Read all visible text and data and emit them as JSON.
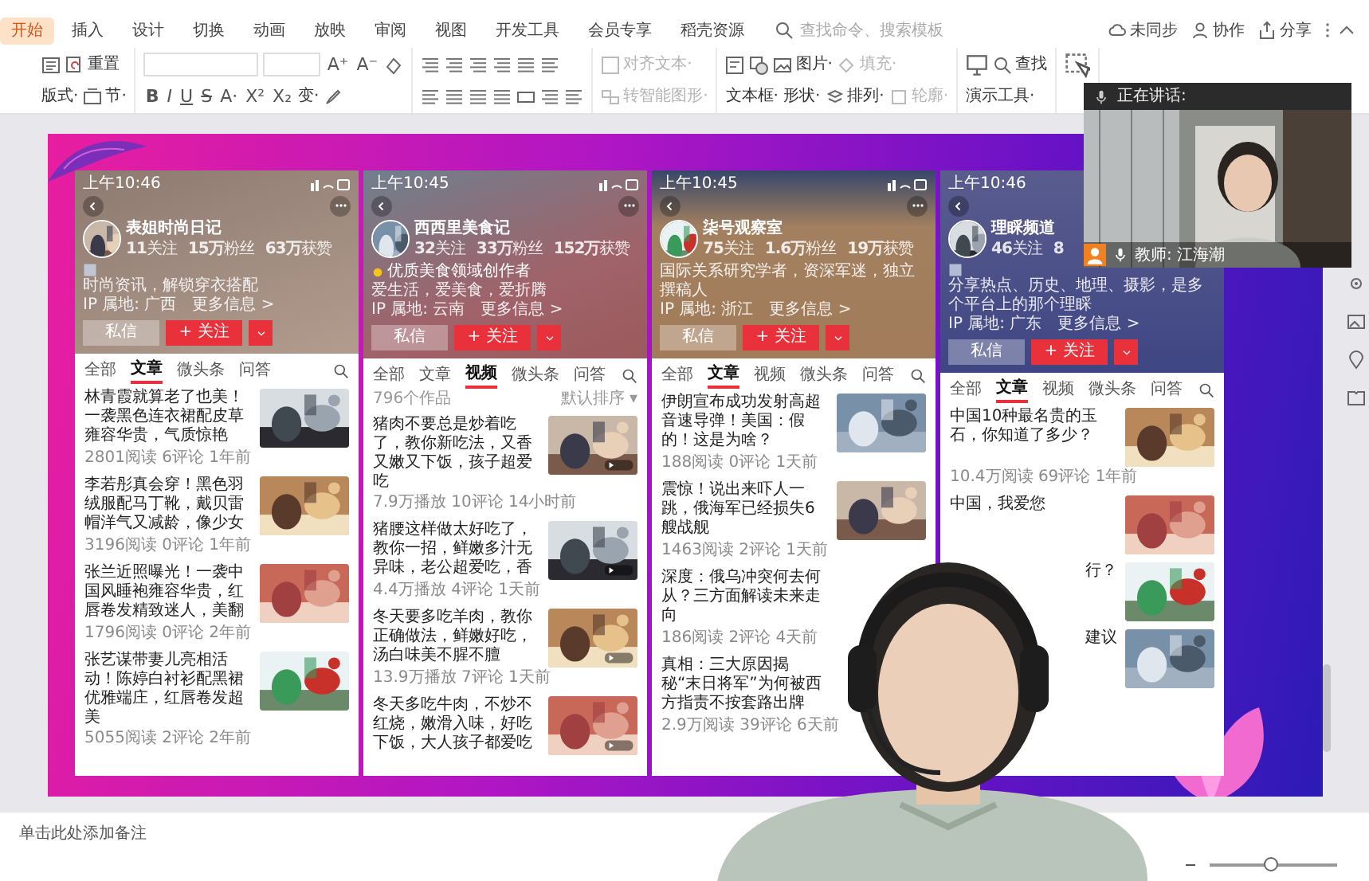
{
  "ribbon": {
    "tabs": [
      {
        "label": "开始",
        "selected": true
      },
      {
        "label": "插入",
        "selected": false
      },
      {
        "label": "设计",
        "selected": false
      },
      {
        "label": "切换",
        "selected": false
      },
      {
        "label": "动画",
        "selected": false
      },
      {
        "label": "放映",
        "selected": false
      },
      {
        "label": "审阅",
        "selected": false
      },
      {
        "label": "视图",
        "selected": false
      },
      {
        "label": "开发工具",
        "selected": false
      },
      {
        "label": "会员专享",
        "selected": false
      },
      {
        "label": "稻壳资源",
        "selected": false
      }
    ],
    "search": {
      "placeholder": "查找命令、搜索模板"
    },
    "actions": [
      {
        "label": "未同步"
      },
      {
        "label": "协作"
      },
      {
        "label": "分享"
      }
    ]
  },
  "toolbar": {
    "labels": [
      {
        "text": "重置",
        "disabled": false
      },
      {
        "text": "对齐文本·",
        "disabled": true
      },
      {
        "text": "图片·",
        "disabled": false
      },
      {
        "text": "填充·",
        "disabled": true
      },
      {
        "text": "查找",
        "disabled": false
      },
      {
        "text": "版式·",
        "disabled": false
      },
      {
        "text": "节·",
        "disabled": false
      },
      {
        "text": "变·",
        "disabled": false
      },
      {
        "text": "转智能图形·",
        "disabled": true
      },
      {
        "text": "文本框·",
        "disabled": false
      },
      {
        "text": "形状·",
        "disabled": false
      },
      {
        "text": "排列·",
        "disabled": false
      },
      {
        "text": "轮廓·",
        "disabled": true
      },
      {
        "text": "演示工具·",
        "disabled": false
      }
    ],
    "glyphs": [
      "A⁺",
      "A⁻",
      "B",
      "I",
      "U",
      "S",
      "A·",
      "X²",
      "X₂"
    ]
  },
  "slide": {
    "phones": [
      {
        "time": "上午10:46",
        "status_icons": true,
        "more_button": true,
        "name": "表姐时尚日记",
        "stats": [
          "**11**关注",
          "**15万**粉丝",
          "**63万**获赞"
        ],
        "badge": {
          "kind": "icon"
        },
        "bio": [
          "时尚资讯，解锁穿衣搭配"
        ],
        "ip": "IP 属地: 广西　更多信息 >",
        "buttons": [
          "私信",
          "+ 关注"
        ],
        "tabs": [
          {
            "label": "全部",
            "selected": false
          },
          {
            "label": "文章",
            "selected": true
          },
          {
            "label": "微头条",
            "selected": false
          },
          {
            "label": "问答",
            "selected": false
          }
        ],
        "articles": [
          {
            "kind": "article",
            "title": "林青霞就算老了也美！一袭黑色连衣裙配皮草雍容华贵，气质惊艳",
            "meta": "2801阅读 6评论 1年前"
          },
          {
            "kind": "article",
            "title": "李若彤真会穿！黑色羽绒服配马丁靴，戴贝雷帽洋气又减龄，像少女",
            "meta": "3196阅读 0评论 1年前"
          },
          {
            "kind": "article",
            "title": "张兰近照曝光！一袭中国风睡袍雍容华贵，红唇卷发精致迷人，美翻",
            "meta": "1796阅读 0评论 2年前"
          },
          {
            "kind": "article",
            "title": "张艺谋带妻儿亮相活动！陈婷白衬衫配黑裙优雅端庄，红唇卷发超美",
            "meta": "5055阅读 2评论 2年前"
          }
        ]
      },
      {
        "time": "上午10:45",
        "status_icons": true,
        "more_button": true,
        "name": "西西里美食记",
        "stats": [
          "**32**关注",
          "**33万**粉丝",
          "**152万**获赞"
        ],
        "badge": {
          "kind": "label",
          "text": "优质美食领域创作者"
        },
        "bio": [
          "爱生活，爱美食，爱折腾"
        ],
        "ip": "IP 属地: 云南　更多信息 >",
        "buttons": [
          "私信",
          "+ 关注"
        ],
        "tabs": [
          {
            "label": "全部",
            "selected": false
          },
          {
            "label": "文章",
            "selected": false
          },
          {
            "label": "视频",
            "selected": true
          },
          {
            "label": "微头条",
            "selected": false
          },
          {
            "label": "问答",
            "selected": false
          }
        ],
        "sort": {
          "count": "796个作品",
          "order": "默认排序 ▾"
        },
        "articles": [
          {
            "kind": "video",
            "title": "猪肉不要总是炒着吃了，教你新吃法，又香又嫩又下饭，孩子超爱吃",
            "meta": "7.9万播放 10评论 14小时前"
          },
          {
            "kind": "video",
            "title": "猪腰这样做太好吃了，教你一招，鲜嫩多汁无异味，老公超爱吃，香",
            "meta": "4.4万播放 4评论 1天前"
          },
          {
            "kind": "video",
            "title": "冬天要多吃羊肉，教你正确做法，鲜嫩好吃，汤白味美不腥不膻",
            "meta": "13.9万播放 7评论 1天前"
          },
          {
            "kind": "video",
            "title": "冬天多吃牛肉，不炒不红烧，嫩滑入味，好吃下饭，大人孩子都爱吃"
          }
        ]
      },
      {
        "time": "上午10:45",
        "status_icons": true,
        "more_button": true,
        "name": "柒号观察室",
        "stats": [
          "**75**关注",
          "**1.6万**粉丝",
          "**19万**获赞"
        ],
        "bio": [
          "国际关系研究学者，资深军迷，独立撰稿人"
        ],
        "ip": "IP 属地: 浙江　更多信息 >",
        "buttons": [
          "私信",
          "+ 关注"
        ],
        "tabs": [
          {
            "label": "全部",
            "selected": false
          },
          {
            "label": "文章",
            "selected": true
          },
          {
            "label": "视频",
            "selected": false
          },
          {
            "label": "微头条",
            "selected": false
          },
          {
            "label": "问答",
            "selected": false
          }
        ],
        "articles": [
          {
            "kind": "article",
            "title": "伊朗宣布成功发射高超音速导弹！美国：假的！这是为啥？",
            "meta": "188阅读 0评论 1天前"
          },
          {
            "kind": "article",
            "title": "震惊！说出来吓人一跳，俄海军已经损失6艘战舰",
            "meta": "1463阅读 2评论 1天前"
          },
          {
            "kind": "article",
            "title": "深度：俄乌冲突何去何从？三方面解读未来走向",
            "meta": "186阅读 2评论 4天前"
          },
          {
            "kind": "article",
            "title": "真相：三大原因揭秘“末日将军”为何被西方指责不按套路出牌",
            "meta": "2.9万阅读 39评论 6天前"
          }
        ]
      },
      {
        "time": "上午10:46",
        "name": "理睬频道",
        "stats": [
          "**46**关注",
          "8"
        ],
        "badge": {
          "kind": "icon"
        },
        "bio": [
          "分享热点、历史、地理、摄影，是多个平台上的那个理睬"
        ],
        "ip": "IP 属地: 广东　更多信息 >",
        "buttons": [
          "私信",
          "+ 关注"
        ],
        "tabs": [
          {
            "label": "全部",
            "selected": false
          },
          {
            "label": "文章",
            "selected": true
          },
          {
            "label": "视频",
            "selected": false
          },
          {
            "label": "微头条",
            "selected": false
          },
          {
            "label": "问答",
            "selected": false
          }
        ],
        "articles": [
          {
            "kind": "article",
            "title": "中国10种最名贵的玉石，你知道了多少？",
            "meta": "10.4万阅读 69评论 1年前"
          },
          {
            "kind": "article",
            "title": "中国，我爱您"
          },
          {
            "kind": "cut",
            "title": "行？"
          },
          {
            "kind": "cut",
            "title": "建议"
          }
        ]
      }
    ]
  },
  "speaker_panel": {
    "title": "正在讲话:",
    "name": "教师: 江海潮"
  },
  "notes": {
    "placeholder": "单击此处添加备注"
  },
  "status_bar": {
    "zoom": {
      "level": 0.47
    }
  }
}
